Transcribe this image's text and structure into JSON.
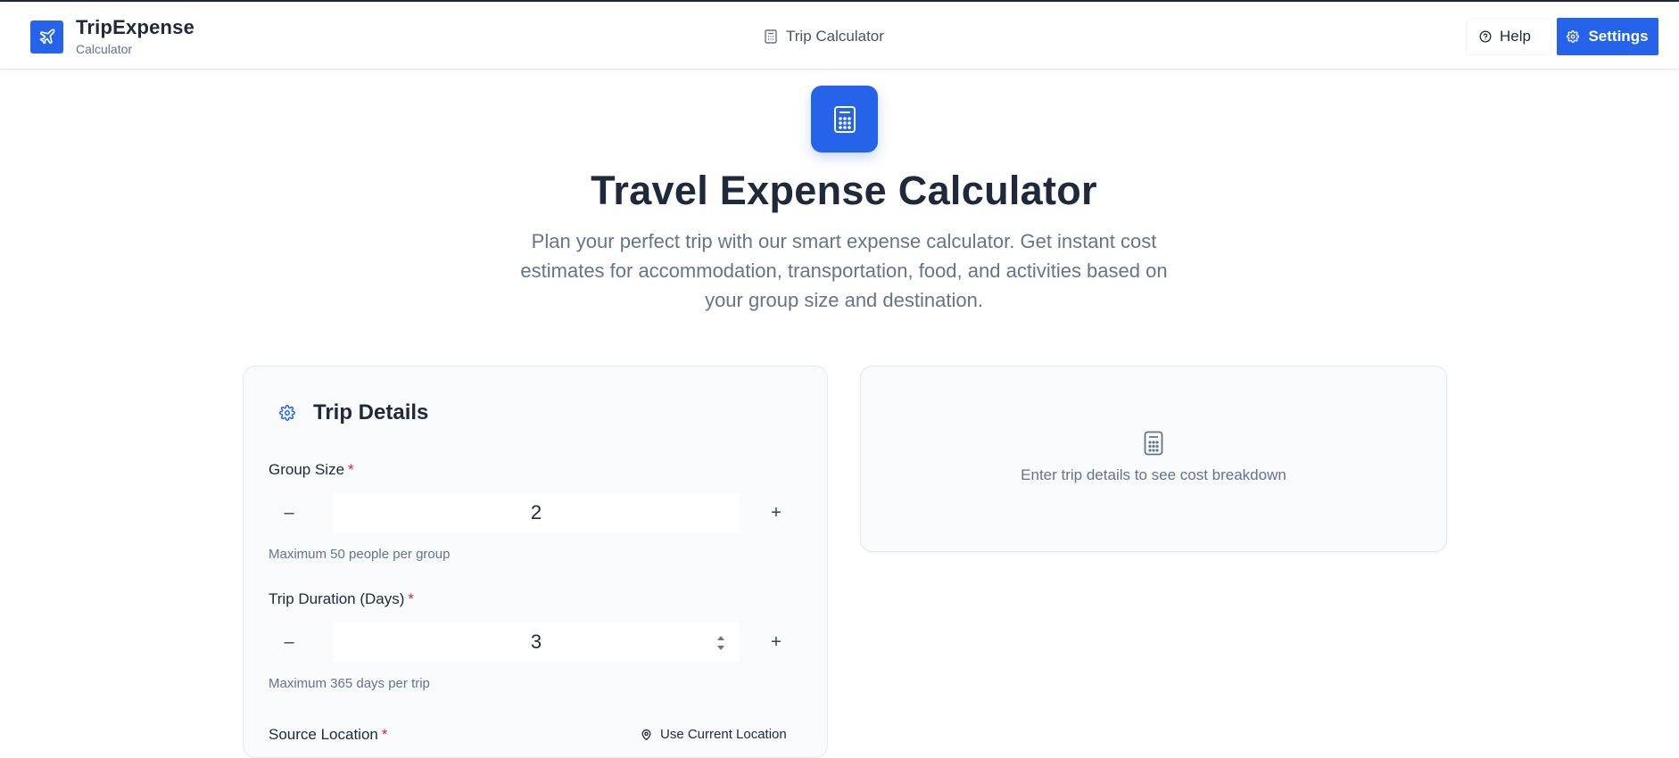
{
  "header": {
    "brand_name": "TripExpense",
    "brand_sub": "Calculator",
    "center_nav_label": "Trip Calculator",
    "help_label": "Help",
    "settings_label": "Settings"
  },
  "hero": {
    "title": "Travel Expense Calculator",
    "description": "Plan your perfect trip with our smart expense calculator. Get instant cost estimates for accommodation, transportation, food, and activities based on your group size and destination."
  },
  "form": {
    "title": "Trip Details",
    "group_size": {
      "label": "Group Size",
      "required_mark": "*",
      "minus": "–",
      "value": "2",
      "plus": "+",
      "hint": "Maximum 50 people per group"
    },
    "duration": {
      "label": "Trip Duration (Days)",
      "required_mark": "*",
      "minus": "–",
      "value": "3",
      "plus": "+",
      "hint": "Maximum 365 days per trip"
    },
    "source": {
      "label": "Source Location",
      "required_mark": "*",
      "use_location_label": "Use Current Location"
    }
  },
  "result": {
    "empty_text": "Enter trip details to see cost breakdown"
  },
  "colors": {
    "accent": "#2563eb",
    "required": "#dc2626",
    "text": "#1e293b",
    "muted": "#64748b"
  },
  "icons": {
    "brand": "plane-icon",
    "center_nav": "calculator-icon",
    "help": "help-circle-icon",
    "settings": "gear-icon",
    "hero": "calculator-icon",
    "card_title": "gear-icon",
    "result": "calculator-icon",
    "location": "map-pin-icon"
  }
}
